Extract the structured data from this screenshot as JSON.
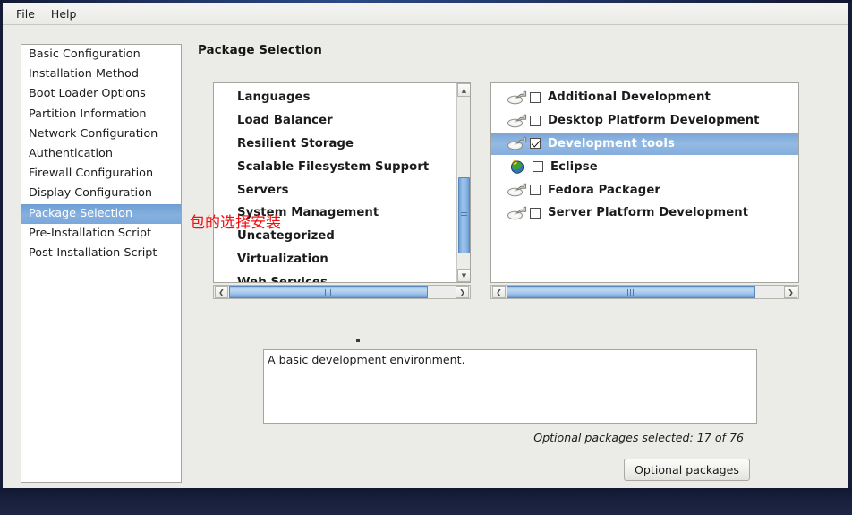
{
  "window": {
    "menu": [
      {
        "label": "File",
        "name": "menu-file"
      },
      {
        "label": "Help",
        "name": "menu-help"
      }
    ]
  },
  "sidebar": {
    "items": [
      {
        "label": "Basic Configuration",
        "selected": false
      },
      {
        "label": "Installation Method",
        "selected": false
      },
      {
        "label": "Boot Loader Options",
        "selected": false
      },
      {
        "label": "Partition Information",
        "selected": false
      },
      {
        "label": "Network Configuration",
        "selected": false
      },
      {
        "label": "Authentication",
        "selected": false
      },
      {
        "label": "Firewall Configuration",
        "selected": false
      },
      {
        "label": "Display Configuration",
        "selected": false
      },
      {
        "label": "Package Selection",
        "selected": true
      },
      {
        "label": "Pre-Installation Script",
        "selected": false
      },
      {
        "label": "Post-Installation Script",
        "selected": false
      }
    ]
  },
  "main": {
    "title": "Package Selection",
    "group_list": {
      "items": [
        {
          "label": "Languages"
        },
        {
          "label": "Load Balancer"
        },
        {
          "label": "Resilient Storage"
        },
        {
          "label": "Scalable Filesystem Support"
        },
        {
          "label": "Servers"
        },
        {
          "label": "System Management"
        },
        {
          "label": "Uncategorized"
        },
        {
          "label": "Virtualization"
        },
        {
          "label": "Web Services"
        }
      ],
      "vscroll": {
        "thumb_top_pct": 47,
        "thumb_height_pct": 44
      },
      "hscroll": {
        "thumb_left_pct": 0,
        "thumb_width_pct": 88
      }
    },
    "package_list": {
      "items": [
        {
          "label": "Additional Development",
          "checked": false,
          "selected": false,
          "icon": "package-icon"
        },
        {
          "label": "Desktop Platform Development",
          "checked": false,
          "selected": false,
          "icon": "package-icon"
        },
        {
          "label": "Development tools",
          "checked": true,
          "selected": true,
          "icon": "package-icon"
        },
        {
          "label": "Eclipse",
          "checked": false,
          "selected": false,
          "icon": "globe-icon"
        },
        {
          "label": "Fedora Packager",
          "checked": false,
          "selected": false,
          "icon": "package-icon"
        },
        {
          "label": "Server Platform Development",
          "checked": false,
          "selected": false,
          "icon": "package-icon"
        }
      ],
      "hscroll": {
        "thumb_left_pct": 0,
        "thumb_width_pct": 90
      }
    },
    "description": "A basic development environment.",
    "optional_count_text": "Optional packages selected: 17 of 76",
    "optional_button_label": "Optional packages"
  },
  "annotation": {
    "text": "包的选择安装",
    "color": "#f10f0f"
  },
  "colors": {
    "selection_blue": "#85b0df",
    "row_selection_blue": "#93bae4",
    "background": "#ebebe7",
    "list_background": "#ffffff",
    "border": "#a5a5a0",
    "scrollbar_thumb": "#9cc2ea",
    "window_frame": "#141c37"
  }
}
